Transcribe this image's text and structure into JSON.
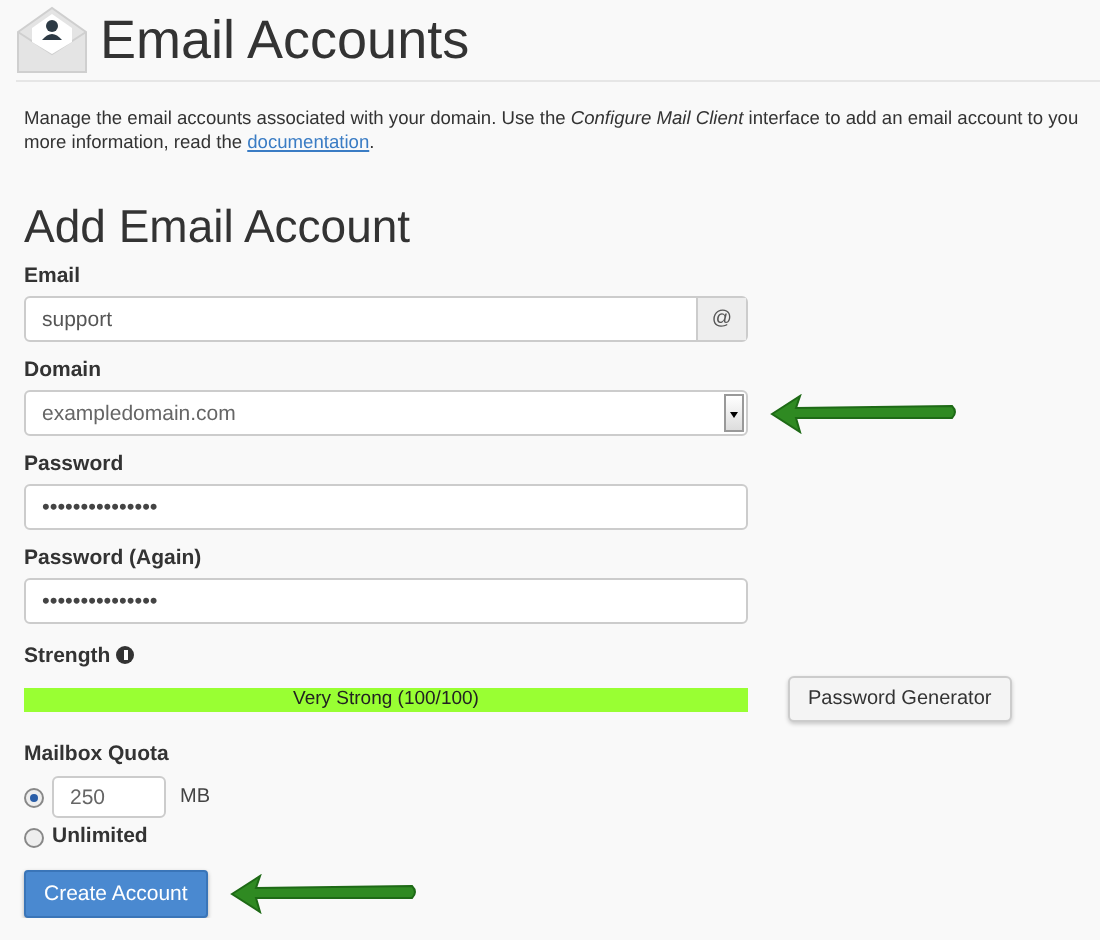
{
  "header": {
    "title": "Email Accounts"
  },
  "intro": {
    "line_1": "Manage the email accounts associated with your domain. Use the *Configure Mail Client* interface to add an email account to you",
    "line_2": "more information, read the ",
    "link": "documentation",
    "after": "."
  },
  "form": {
    "title": "Add Email Account",
    "email": {
      "label": "Email",
      "value": "support",
      "addon": "@"
    },
    "domain": {
      "label": "Domain",
      "value": "exampledomain.com"
    },
    "password": {
      "label": "Password",
      "value": "•••••••••••••••"
    },
    "password_again": {
      "label": "Password (Again)",
      "value": "•••••••••••••••"
    },
    "strength": {
      "label": "Strength",
      "level": 1,
      "reading": "Very Strong (100/100)"
    },
    "generator_button": "Password Generator",
    "quota": {
      "label": "Mailbox Quota",
      "options": [
        {
          "kind": "amount",
          "selected": true,
          "value": "250",
          "unit": "MB"
        },
        {
          "kind": "unlimited",
          "selected": false,
          "label": "Unlimited"
        }
      ]
    },
    "submit_button": "Create Account"
  }
}
